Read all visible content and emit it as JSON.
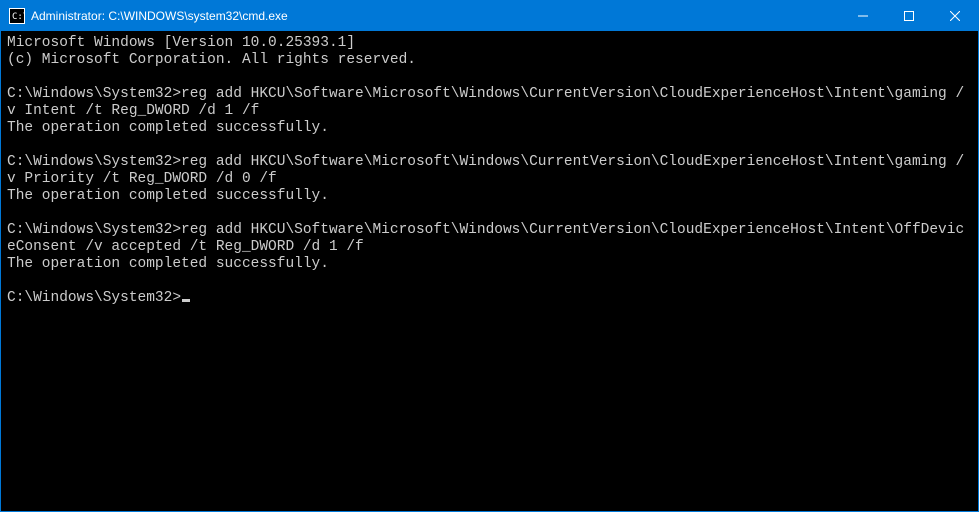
{
  "window": {
    "title": "Administrator: C:\\WINDOWS\\system32\\cmd.exe"
  },
  "terminal": {
    "banner_line1": "Microsoft Windows [Version 10.0.25393.1]",
    "banner_line2": "(c) Microsoft Corporation. All rights reserved.",
    "prompt": "C:\\Windows\\System32>",
    "entries": [
      {
        "command": "reg add HKCU\\Software\\Microsoft\\Windows\\CurrentVersion\\CloudExperienceHost\\Intent\\gaming /v Intent /t Reg_DWORD /d 1 /f",
        "output": "The operation completed successfully."
      },
      {
        "command": "reg add HKCU\\Software\\Microsoft\\Windows\\CurrentVersion\\CloudExperienceHost\\Intent\\gaming /v Priority /t Reg_DWORD /d 0 /f",
        "output": "The operation completed successfully."
      },
      {
        "command": "reg add HKCU\\Software\\Microsoft\\Windows\\CurrentVersion\\CloudExperienceHost\\Intent\\OffDeviceConsent /v accepted /t Reg_DWORD /d 1 /f",
        "output": "The operation completed successfully."
      }
    ]
  }
}
